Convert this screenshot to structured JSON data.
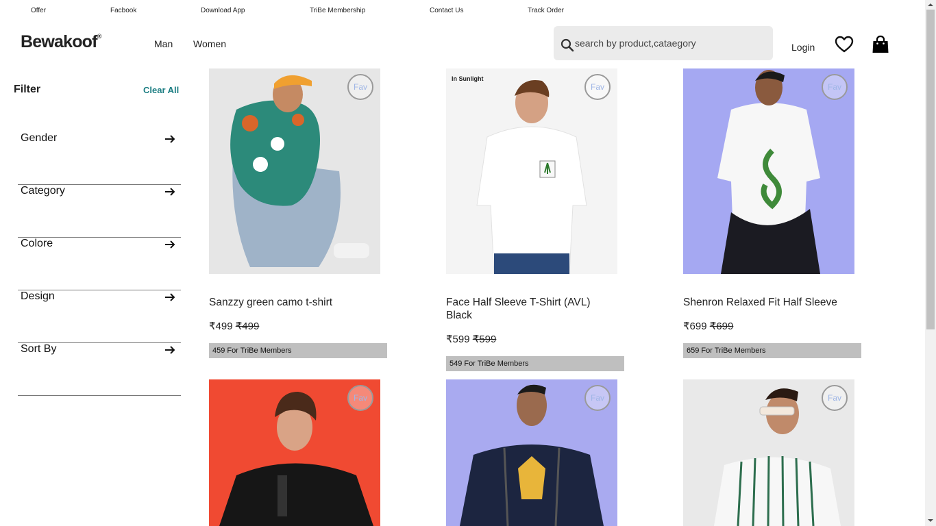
{
  "topbar": {
    "links": [
      "Offer",
      "Facbook",
      "Download App",
      "TriBe Membership",
      "Contact Us",
      "Track Order"
    ]
  },
  "header": {
    "logo": "Bewakoof",
    "logo_mark": "®",
    "nav": [
      "Man",
      "Women"
    ],
    "search_placeholder": "search by product,cataegory",
    "login": "Login"
  },
  "filters": {
    "title": "Filter",
    "clear_all": "Clear All",
    "items": [
      "Gender",
      "Category",
      "Colore",
      "Design",
      "Sort By"
    ]
  },
  "products": [
    {
      "name": "Sanzzy green camo t-shirt",
      "price": "₹499",
      "mrp": "₹499",
      "tribe": "459 For TriBe Members",
      "fav": "Fav",
      "bg": "#e6e6e6"
    },
    {
      "name": "Face Half Sleeve T-Shirt (AVL) Black",
      "price": "₹599",
      "mrp": "₹599",
      "tribe": "549 For TriBe Members",
      "fav": "Fav",
      "bg": "#f4f4f4",
      "badge": "In Sunlight"
    },
    {
      "name": "Shenron Relaxed Fit Half Sleeve",
      "price": "₹699",
      "mrp": "₹699",
      "tribe": "659 For TriBe Members",
      "fav": "Fav",
      "bg": "#a5a8f2"
    },
    {
      "fav": "Fav",
      "bg": "#f04a32"
    },
    {
      "fav": "Fav",
      "bg": "#a9aaf0"
    },
    {
      "fav": "Fav",
      "bg": "#e9e9e9"
    }
  ],
  "colors": {
    "accent": "#1b7d82",
    "tribe_bg": "#bfbfbf",
    "search_bg": "#ebebeb"
  }
}
